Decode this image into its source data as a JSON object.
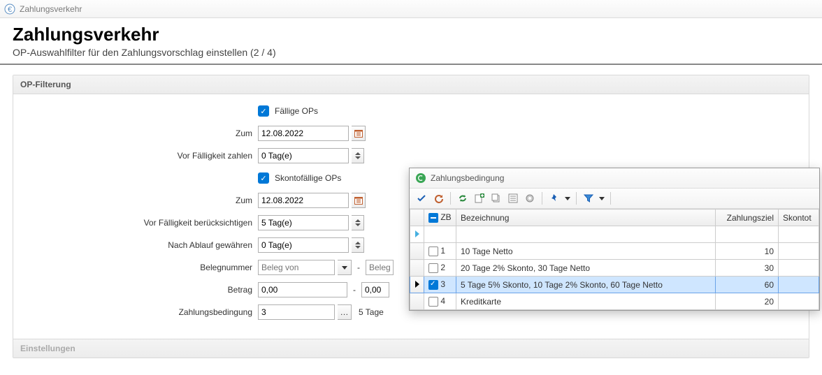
{
  "window": {
    "title": "Zahlungsverkehr"
  },
  "header": {
    "title": "Zahlungsverkehr",
    "subtitle": "OP-Auswahlfilter für den Zahlungsvorschlag einstellen (2 / 4)"
  },
  "panel": {
    "title": "OP-Filterung",
    "faellige_label": "Fällige OPs",
    "zum1_label": "Zum",
    "zum1_value": "12.08.2022",
    "vor_faelligkeit_label": "Vor Fälligkeit zahlen",
    "vor_faelligkeit_value": "0 Tag(e)",
    "skonto_label": "Skontofällige OPs",
    "zum2_label": "Zum",
    "zum2_value": "12.08.2022",
    "vor_beruck_label": "Vor Fälligkeit berücksichtigen",
    "vor_beruck_value": "5 Tag(e)",
    "nach_ablauf_label": "Nach Ablauf gewähren",
    "nach_ablauf_value": "0 Tag(e)",
    "beleg_label": "Belegnummer",
    "beleg_from_ph": "Beleg von",
    "beleg_to_ph": "Beleg",
    "betrag_label": "Betrag",
    "betrag_from": "0,00",
    "betrag_to": "0,00",
    "zb_label": "Zahlungsbedingung",
    "zb_value": "3",
    "zb_desc": "5 Tage"
  },
  "panel2": {
    "title": "Einstellungen"
  },
  "popup": {
    "title": "Zahlungsbedingung",
    "columns": {
      "zb": "ZB",
      "bez": "Bezeichnung",
      "ziel": "Zahlungsziel",
      "skontot": "Skontot"
    },
    "rows": [
      {
        "zb": "1",
        "bez": "10 Tage Netto",
        "ziel": "10",
        "checked": false
      },
      {
        "zb": "2",
        "bez": "20 Tage 2% Skonto, 30 Tage Netto",
        "ziel": "30",
        "checked": false
      },
      {
        "zb": "3",
        "bez": "5 Tage 5% Skonto, 10 Tage 2% Skonto, 60 Tage Netto",
        "ziel": "60",
        "checked": true
      },
      {
        "zb": "4",
        "bez": "Kreditkarte",
        "ziel": "20",
        "checked": false
      }
    ]
  }
}
